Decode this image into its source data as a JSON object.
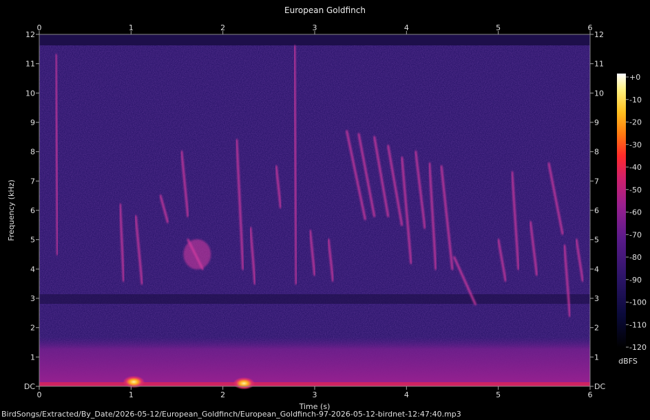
{
  "chart_data": {
    "type": "heatmap",
    "title": "European Goldfinch",
    "xlabel": "Time (s)",
    "ylabel": "Frequency (kHz)",
    "x_ticks": [
      "0",
      "1",
      "2",
      "3",
      "4",
      "5",
      "6"
    ],
    "y_ticks": [
      "DC",
      "1",
      "2",
      "3",
      "4",
      "5",
      "6",
      "7",
      "8",
      "9",
      "10",
      "11",
      "12"
    ],
    "xlim": [
      0,
      6
    ],
    "ylim": [
      0,
      12
    ],
    "colorbar": {
      "unit": "dBFS",
      "ticks": [
        "+0",
        "-10",
        "-20",
        "-30",
        "-40",
        "-50",
        "-60",
        "-70",
        "-80",
        "-90",
        "-100",
        "-110",
        "-120"
      ],
      "range": [
        -120,
        0
      ]
    },
    "colors": {
      "background": "#000000",
      "base_noise": "#2a1466",
      "low_band": "#8a1f8a",
      "call": "#d63aa0",
      "hot": "#ffd24a"
    },
    "calls": [
      {
        "t0": 0.18,
        "t1": 0.2,
        "f0": 11.3,
        "f1": 4.5
      },
      {
        "t0": 0.88,
        "t1": 0.92,
        "f0": 6.2,
        "f1": 3.6
      },
      {
        "t0": 1.05,
        "t1": 1.12,
        "f0": 5.8,
        "f1": 3.5
      },
      {
        "t0": 1.32,
        "t1": 1.4,
        "f0": 6.5,
        "f1": 5.6
      },
      {
        "t0": 1.55,
        "t1": 1.62,
        "f0": 8.0,
        "f1": 5.8
      },
      {
        "t0": 1.62,
        "t1": 1.78,
        "f0": 5.0,
        "f1": 4.0
      },
      {
        "t0": 2.15,
        "t1": 2.22,
        "f0": 8.4,
        "f1": 4.0
      },
      {
        "t0": 2.3,
        "t1": 2.35,
        "f0": 5.4,
        "f1": 3.5
      },
      {
        "t0": 2.58,
        "t1": 2.63,
        "f0": 7.5,
        "f1": 6.1
      },
      {
        "t0": 2.78,
        "t1": 2.8,
        "f0": 11.6,
        "f1": 3.5
      },
      {
        "t0": 2.95,
        "t1": 3.0,
        "f0": 5.3,
        "f1": 3.8
      },
      {
        "t0": 3.15,
        "t1": 3.2,
        "f0": 5.0,
        "f1": 3.6
      },
      {
        "t0": 3.35,
        "t1": 3.55,
        "f0": 8.7,
        "f1": 5.7
      },
      {
        "t0": 3.48,
        "t1": 3.65,
        "f0": 8.6,
        "f1": 5.8
      },
      {
        "t0": 3.65,
        "t1": 3.8,
        "f0": 8.5,
        "f1": 5.8
      },
      {
        "t0": 3.8,
        "t1": 3.95,
        "f0": 8.2,
        "f1": 5.5
      },
      {
        "t0": 3.95,
        "t1": 4.05,
        "f0": 7.8,
        "f1": 4.2
      },
      {
        "t0": 4.1,
        "t1": 4.2,
        "f0": 8.0,
        "f1": 5.4
      },
      {
        "t0": 4.25,
        "t1": 4.32,
        "f0": 7.6,
        "f1": 4.0
      },
      {
        "t0": 4.38,
        "t1": 4.5,
        "f0": 7.5,
        "f1": 4.0
      },
      {
        "t0": 4.52,
        "t1": 4.75,
        "f0": 4.4,
        "f1": 2.8
      },
      {
        "t0": 5.0,
        "t1": 5.08,
        "f0": 5.0,
        "f1": 3.6
      },
      {
        "t0": 5.15,
        "t1": 5.22,
        "f0": 7.3,
        "f1": 4.0
      },
      {
        "t0": 5.35,
        "t1": 5.42,
        "f0": 5.6,
        "f1": 3.8
      },
      {
        "t0": 5.55,
        "t1": 5.7,
        "f0": 7.6,
        "f1": 5.2
      },
      {
        "t0": 5.72,
        "t1": 5.78,
        "f0": 4.8,
        "f1": 2.4
      },
      {
        "t0": 5.85,
        "t1": 5.92,
        "f0": 5.0,
        "f1": 3.6
      }
    ],
    "harmonic_band": {
      "t0": 3.55,
      "t1": 4.55,
      "f": 5.5
    }
  },
  "footer": {
    "filepath": "BirdSongs/Extracted/By_Date/2026-05-12/European_Goldfinch/European_Goldfinch-97-2026-05-12-birdnet-12:47:40.mp3"
  }
}
